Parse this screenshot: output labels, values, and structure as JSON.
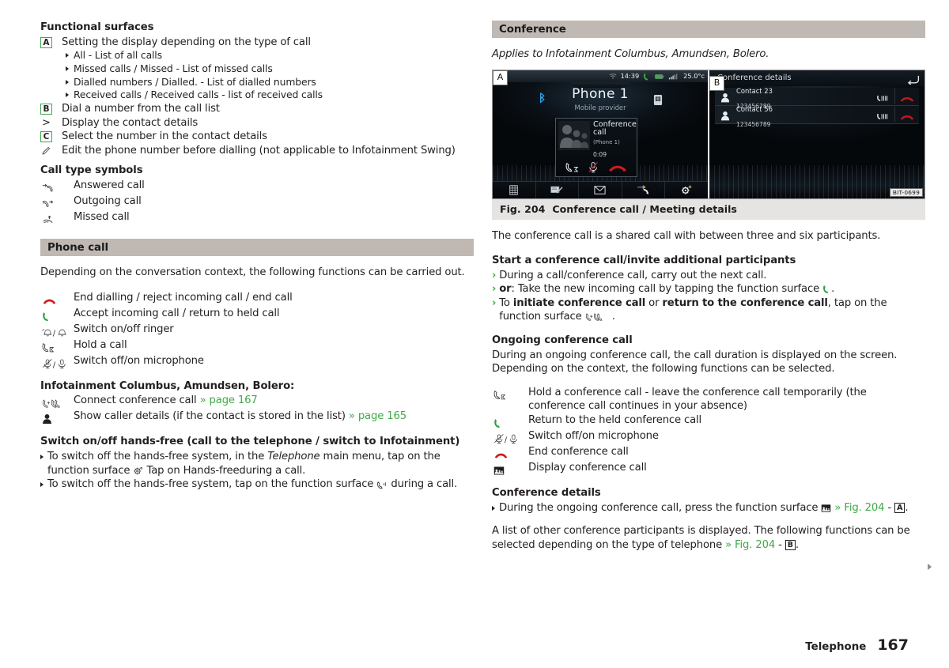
{
  "left": {
    "functional_surfaces_title": "Functional surfaces",
    "items": [
      {
        "key": "A",
        "key_type": "boxed",
        "text": "Setting the display depending on the type of call"
      },
      {
        "key": ">",
        "key_type": "plain",
        "text": "Display the contact details"
      },
      {
        "key": "B",
        "key_type": "boxed",
        "text": "Dial a number from the call list"
      },
      {
        "key": "C",
        "key_type": "boxed",
        "text": "Select the number in the contact details"
      }
    ],
    "sub_items": [
      "All - List of all calls",
      "Missed calls / Missed - List of missed calls",
      "Dialled numbers / Dialled. - List of dialled numbers",
      "Received calls / Received calls - list of received calls"
    ],
    "item_b": "Dial a number from the call list",
    "item_gt": "Display the contact details",
    "item_c": "Select the number in the contact details",
    "item_pencil": "Edit the phone number before dialling (not applicable to Infotainment Swing)",
    "call_type_title": "Call type symbols",
    "call_types": [
      {
        "icon": "answered-call-icon",
        "text": "Answered call"
      },
      {
        "icon": "outgoing-call-icon",
        "text": "Outgoing call"
      },
      {
        "icon": "missed-call-icon",
        "text": "Missed call"
      }
    ],
    "phone_call_band": "Phone call",
    "phone_call_intro": "Depending on the conversation context, the following functions can be carried out.",
    "phone_functions": [
      {
        "icon": "end-call-icon",
        "text": "End dialling / reject incoming call / end call"
      },
      {
        "icon": "accept-call-icon",
        "text": "Accept incoming call / return to held call"
      },
      {
        "icon": "ringer-toggle-icon",
        "text": "Switch on/off ringer"
      },
      {
        "icon": "hold-call-icon",
        "text": "Hold a call"
      },
      {
        "icon": "microphone-toggle-icon",
        "text": "Switch off/on microphone"
      }
    ],
    "infotainment_title": "Infotainment Columbus, Amundsen, Bolero:",
    "infotainment_functions": [
      {
        "icon": "conference-call-icon",
        "text": "Connect conference call",
        "link": "» page 167"
      },
      {
        "icon": "caller-details-icon",
        "text": "Show caller details (if the contact is stored in the list)",
        "link": "» page 165"
      }
    ],
    "handsfree_title": "Switch on/off hands-free (call to the telephone / switch to Infotainment)",
    "handsfree_b1_p1": "To switch off the hands-free system, in the ",
    "handsfree_b1_italic": "Telephone",
    "handsfree_b1_p2": " main menu, tap on the function surface ",
    "handsfree_b1_p3": " Tap on Hands-freeduring a call.",
    "handsfree_b2_p1": "To switch off the hands-free system, tap on the function surface ",
    "handsfree_b2_p2": " during a call."
  },
  "right": {
    "conference_band": "Conference",
    "applies_to": "Applies to Infotainment Columbus, Amundsen, Bolero.",
    "figure": {
      "callout_a": "A",
      "callout_b": "B",
      "bit_code": "BIT-0699",
      "screen_a": {
        "status_time": "14:39",
        "status_temp": "25.0°c",
        "title": "Phone 1",
        "subtitle": "Mobile provider",
        "card_title": "Conference call",
        "card_sub": "(Phone 1)",
        "card_timer": "0:09",
        "tab_icons": [
          "keypad-icon",
          "notepad-icon",
          "message-icon",
          "call-list-icon",
          "settings-icon"
        ],
        "card_action_icons": [
          "hold-call-icon",
          "microphone-mute-icon",
          "end-call-icon"
        ]
      },
      "screen_b": {
        "title": "Conference details",
        "back_icon": "back-arrow-icon",
        "rows": [
          {
            "name": "Contact 23",
            "number": "123456789"
          },
          {
            "name": "Contact 56",
            "number": "123456789"
          }
        ],
        "row_action_icons": [
          "private-call-icon",
          "end-call-icon"
        ]
      }
    },
    "fig_caption_num": "Fig. 204",
    "fig_caption_text": "Conference call / Meeting details",
    "intro": "The conference call is a shared call with between three and six participants.",
    "start_title": "Start a conference call/invite additional participants",
    "start_b1": "During a call/conference call, carry out the next call.",
    "start_b2_bold": "or",
    "start_b2_rest": ": Take the new incoming call by tapping the function surface ",
    "start_b2_end": ".",
    "start_b3_p1": "To ",
    "start_b3_b1": "initiate conference call",
    "start_b3_p2": " or ",
    "start_b3_b2": "return to the conference call",
    "start_b3_p3": ", tap on the function surface ",
    "start_b3_end": " .",
    "ongoing_title": "Ongoing conference call",
    "ongoing_text": "During an ongoing conference call, the call duration is displayed on the screen. Depending on the context, the following functions can be selected.",
    "ongoing_functions": [
      {
        "icon": "hold-call-icon",
        "text": "Hold a conference call - leave the conference call temporarily (the conference call continues in your absence)"
      },
      {
        "icon": "accept-call-icon",
        "text": "Return to the held conference call"
      },
      {
        "icon": "microphone-toggle-icon",
        "text": "Switch off/on microphone"
      },
      {
        "icon": "end-call-icon",
        "text": "End conference call"
      },
      {
        "icon": "display-conference-icon",
        "text": "Display conference call"
      }
    ],
    "details_title": "Conference details",
    "details_b1_p1": "During the ongoing conference call, press the function surface ",
    "details_b1_link": "» Fig. 204",
    "details_b1_dash": " - ",
    "details_b1_ref": "A",
    "details_b1_end": ".",
    "details_p_p1": "A list of other conference participants is displayed. The following functions can be selected depending on the type of telephone ",
    "details_p_link": "» Fig. 204",
    "details_p_dash": " - ",
    "details_p_ref": "B",
    "details_p_end": "."
  },
  "footer": {
    "label": "Telephone",
    "page": "167"
  },
  "colors": {
    "band": "#bfb8b3",
    "caption_band": "#e6e4e2",
    "green": "#3faa49",
    "red": "#cc1a1a",
    "text": "#231f20"
  }
}
